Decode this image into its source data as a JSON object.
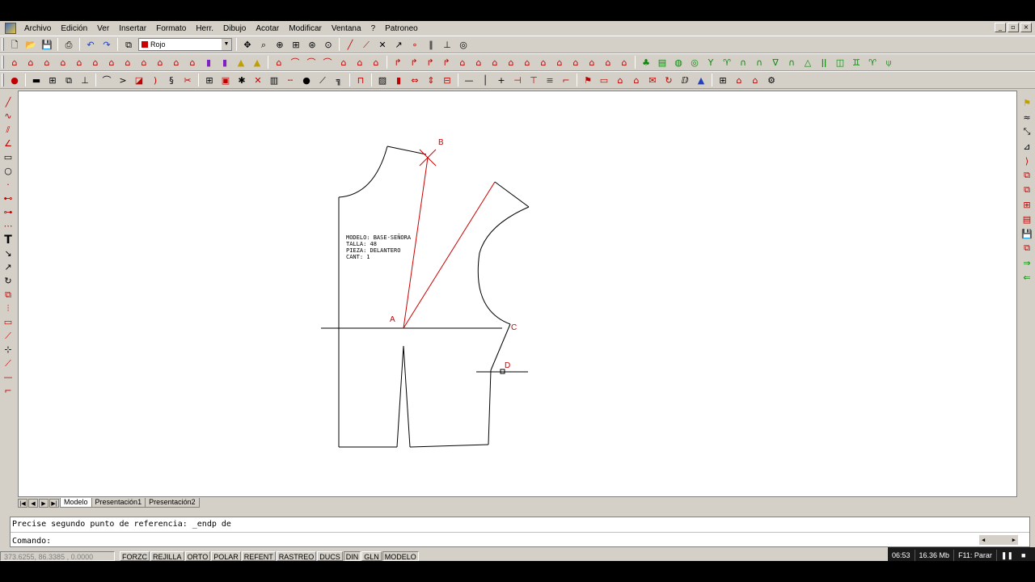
{
  "menu": {
    "items": [
      "Archivo",
      "Edición",
      "Ver",
      "Insertar",
      "Formato",
      "Herr.",
      "Dibujo",
      "Acotar",
      "Modificar",
      "Ventana",
      "?",
      "Patroneo"
    ]
  },
  "window_controls": {
    "minimize": "_",
    "restore": "▫",
    "close": "×"
  },
  "toolbar": {
    "layer_name": "Rojo",
    "layer_color": "#cc0000"
  },
  "drawing": {
    "label_block": [
      "MODELO: BASE-SEÑORA",
      "TALLA: 48",
      "PIEZA: DELANTERO",
      "CANT: 1"
    ],
    "points": {
      "A": "A",
      "B": "B",
      "C": "C",
      "D": "D"
    },
    "line_color": "#000000",
    "construction_color": "#cc0000"
  },
  "tabs": {
    "nav": [
      "|◀",
      "◀",
      "▶",
      "▶|"
    ],
    "items": [
      "Modelo",
      "Presentación1",
      "Presentación2"
    ],
    "active": "Modelo"
  },
  "command": {
    "line1": "Precise segundo punto de referencia: _endp de",
    "line2": "Comando:"
  },
  "status": {
    "coords": "373.6255, 86.3385 , 0.0000",
    "toggles": [
      "FORZC",
      "REJILLA",
      "ORTO",
      "POLAR",
      "REFENT",
      "RASTREO",
      "DUCS",
      "DIN",
      "GLN",
      "MODELO"
    ]
  },
  "player": {
    "time": "06:53",
    "memory": "16.36 Mb",
    "hint": "F11: Parar"
  }
}
